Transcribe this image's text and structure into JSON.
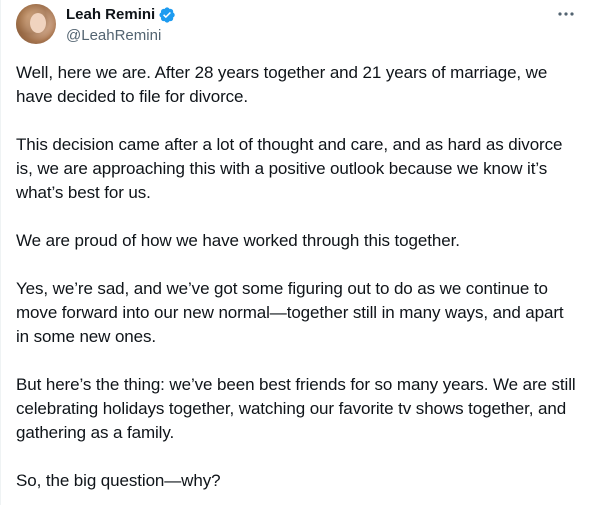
{
  "author": {
    "display_name": "Leah Remini",
    "handle": "@LeahRemini",
    "verified_color": "#1d9bf0"
  },
  "icons": {
    "verified": "verified-badge-icon",
    "more": "more-options-icon"
  },
  "tweet": {
    "paragraphs": [
      "Well, here we are. After 28 years together and 21 years of marriage, we have decided to file for divorce.",
      "This decision came after a lot of thought and care, and as hard as divorce is, we are approaching this with a positive outlook because we know it’s what’s best for us.",
      "We are proud of how we have worked through this together.",
      "Yes, we’re sad, and we’ve got some figuring out to do as we continue to move forward into our new normal—together still in many ways, and apart in some new ones.",
      "But here’s the thing: we’ve been best friends for so many years. We are still celebrating holidays together, watching our favorite tv shows together, and gathering as a family.",
      "So, the big question—why?"
    ]
  }
}
